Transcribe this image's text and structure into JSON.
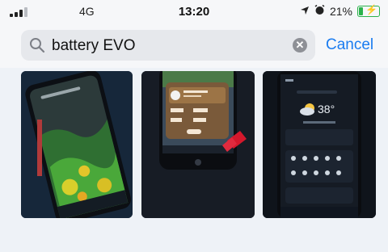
{
  "status_bar": {
    "network": "4G",
    "time": "13:20",
    "battery_percent": "21%",
    "battery_level": 0.21
  },
  "search": {
    "query": "battery EVO",
    "cancel_label": "Cancel"
  },
  "colors": {
    "accent": "#1a7cf0",
    "battery_green": "#2bb24c"
  },
  "screenshots": [
    {
      "description_icon": "radar-map-screenshot"
    },
    {
      "description_icon": "app-card-screenshot"
    },
    {
      "description_icon": "weather-forecast-screenshot"
    }
  ],
  "shot3": {
    "temp": "38°"
  }
}
